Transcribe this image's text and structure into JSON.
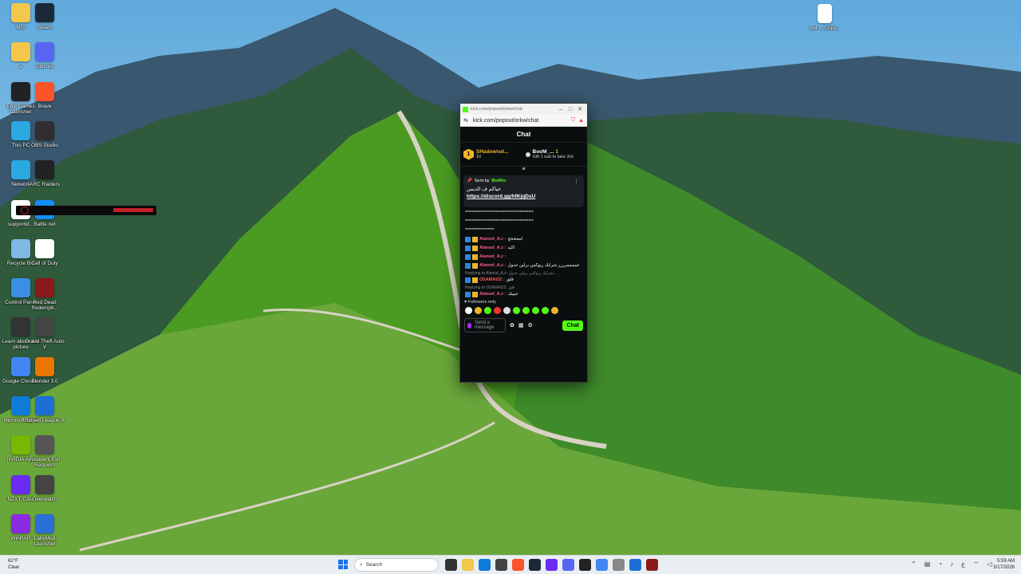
{
  "desktop": {
    "icons": [
      {
        "label": "MSI",
        "color": "#f3c74a"
      },
      {
        "label": "Steam",
        "color": "#1b2838"
      },
      {
        "label": "a",
        "color": "#f3c74a"
      },
      {
        "label": "Discord",
        "color": "#5865f2"
      },
      {
        "label": "Epic Games Launcher",
        "color": "#222222"
      },
      {
        "label": "Brave",
        "color": "#fb542b"
      },
      {
        "label": "This PC",
        "color": "#2aa8e0"
      },
      {
        "label": "OBS Studio",
        "color": "#302e31"
      },
      {
        "label": "Network",
        "color": "#2aa8e0"
      },
      {
        "label": "ARC Raiders",
        "color": "#222222"
      },
      {
        "label": "supportid...",
        "color": "#ffffff"
      },
      {
        "label": "Battle.net",
        "color": "#148eff"
      },
      {
        "label": "Recycle Bin",
        "color": "#7fb8e0"
      },
      {
        "label": "Call of Duty",
        "color": "#ffffff"
      },
      {
        "label": "Control Panel",
        "color": "#3a8ee6"
      },
      {
        "label": "Red Dead Redempti...",
        "color": "#8b1a1a"
      },
      {
        "label": "Learn about this picture",
        "color": "#333333"
      },
      {
        "label": "Grand Theft Auto V",
        "color": "#444444"
      },
      {
        "label": "Google Chrome",
        "color": "#4285f4"
      },
      {
        "label": "Blender 3.0",
        "color": "#ea7600"
      },
      {
        "label": "Microsoft Edge",
        "color": "#0f7bd8"
      },
      {
        "label": "Rocket League ®",
        "color": "#1d6fd6"
      },
      {
        "label": "NVIDIA App",
        "color": "#76b900"
      },
      {
        "label": "Resident Evil Requiem",
        "color": "#555555"
      },
      {
        "label": "NZXT CAM",
        "color": "#6a2cf0"
      },
      {
        "label": "Overwatch",
        "color": "#444444"
      },
      {
        "label": "WinRAR",
        "color": "#8a2be2"
      },
      {
        "label": "LabyMod Launcher",
        "color": "#2a6fd6"
      }
    ],
    "right_file": "SM_...Copy..."
  },
  "window": {
    "title": "kick.com/popout/orkw/chat",
    "url": "kick.com/popout/orkw/chat",
    "chat_header": "Chat",
    "leaderboard": [
      {
        "name": "SHadowisd...",
        "sub": "10"
      },
      {
        "name": "BooM_...",
        "count": "1",
        "sub": "Gift 1 sub to take 3rd"
      }
    ],
    "pinned": {
      "sent_by": "Sent by",
      "bot": "BotRix",
      "text": "حياكم ف الديس",
      "link": "https://discord.gg/hfKjqDsU"
    },
    "messages": [
      {
        "type": "raw",
        "text": "****************************************"
      },
      {
        "type": "raw",
        "text": "****************************************"
      },
      {
        "type": "raw",
        "text": "*****************"
      },
      {
        "user": "Alanod_A.z",
        "text": "امخخخخ"
      },
      {
        "user": "Alanod_A.z",
        "text": "اكيد"
      },
      {
        "user": "Alanod_A.z",
        "text": ""
      },
      {
        "user": "Alanod_A.z",
        "text": "عممممرررر شرايك ريوكس برلين جدول"
      },
      {
        "type": "reply",
        "text": "Replying to Alanod_A.z: شرايك ريوكس برلين جدول..."
      },
      {
        "user2": "OSAMAI22",
        "text": "قلق"
      },
      {
        "type": "reply",
        "text": "Replying to OSAMAI22: قلق"
      },
      {
        "user": "Alanod_A.z",
        "text": "جيييك"
      }
    ],
    "followers_only": "Followers only",
    "input_placeholder": "Send a message",
    "chat_button": "Chat"
  },
  "taskbar": {
    "temp": "62°F",
    "weather": "Clear",
    "search_placeholder": "Search",
    "time": "5:59 AM",
    "date": "3/17/2026"
  }
}
